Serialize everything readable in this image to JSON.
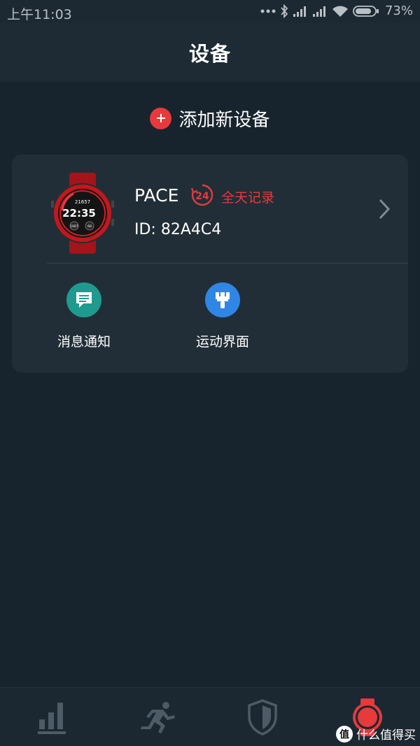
{
  "status_bar": {
    "time": "上午11:03",
    "battery": "73%",
    "icons": [
      "more-dots-icon",
      "bluetooth-icon",
      "signal-icon",
      "signal-icon",
      "wifi-icon",
      "battery-icon"
    ]
  },
  "header": {
    "title": "设备"
  },
  "add_device": {
    "label": "添加新设备",
    "icon": "plus-icon"
  },
  "device": {
    "name": "PACE",
    "all_day_badge": "24",
    "all_day_label": "全天记录",
    "id_text": "ID: 82A4C4",
    "watch_face_time": "22:35",
    "watch_face_steps": "21657",
    "watch_face_left": "1667",
    "watch_face_right": "68"
  },
  "features": [
    {
      "label": "消息通知",
      "icon": "message-icon"
    },
    {
      "label": "运动界面",
      "icon": "brush-icon"
    }
  ],
  "bottom_nav": {
    "items": [
      "stats-icon",
      "running-icon",
      "shield-icon",
      "watch-icon"
    ],
    "active": "watch-icon"
  },
  "watermark": {
    "badge": "值",
    "text": "什么值得买"
  },
  "colors": {
    "background": "#18242d",
    "card": "#212e37",
    "accent_red": "#e63a3d",
    "teal": "#1f9a8f",
    "blue": "#2f86e5",
    "nav_inactive": "#4d5b66"
  }
}
